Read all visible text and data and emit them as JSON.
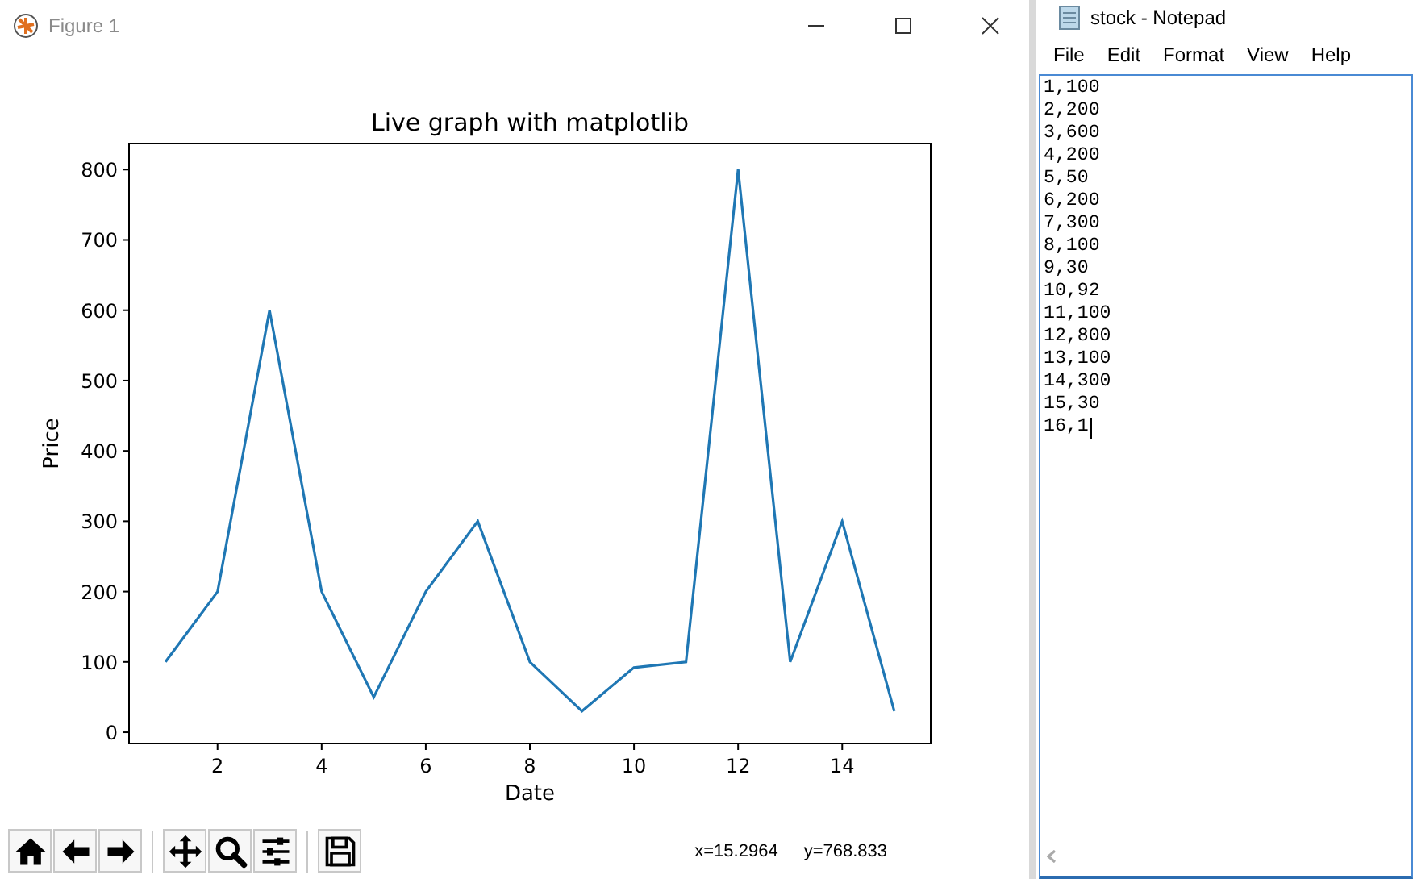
{
  "figure_window": {
    "title": "Figure 1",
    "chart_data": {
      "type": "line",
      "title": "Live graph with matplotlib",
      "xlabel": "Date",
      "ylabel": "Price",
      "x": [
        1,
        2,
        3,
        4,
        5,
        6,
        7,
        8,
        9,
        10,
        11,
        12,
        13,
        14,
        15
      ],
      "series": [
        {
          "color": "#1f77b4",
          "values": [
            100,
            200,
            600,
            200,
            50,
            200,
            300,
            100,
            30,
            92,
            100,
            800,
            100,
            300,
            30
          ]
        }
      ],
      "xlim": [
        0.3,
        15.7
      ],
      "ylim": [
        -16,
        837
      ],
      "xticks": [
        2,
        4,
        6,
        8,
        10,
        12,
        14
      ],
      "yticks": [
        0,
        100,
        200,
        300,
        400,
        500,
        600,
        700,
        800
      ]
    },
    "coordinates": [
      "x=15.2964",
      "y=768.833"
    ]
  },
  "notepad": {
    "title": "stock - Notepad",
    "menu": [
      "File",
      "Edit",
      "Format",
      "View",
      "Help"
    ],
    "lines": [
      "1,100",
      "2,200",
      "3,600",
      "4,200",
      "5,50",
      "6,200",
      "7,300",
      "8,100",
      "9,30",
      "10,92",
      "11,100",
      "12,800",
      "13,100",
      "14,300",
      "15,30",
      "16,1"
    ]
  }
}
